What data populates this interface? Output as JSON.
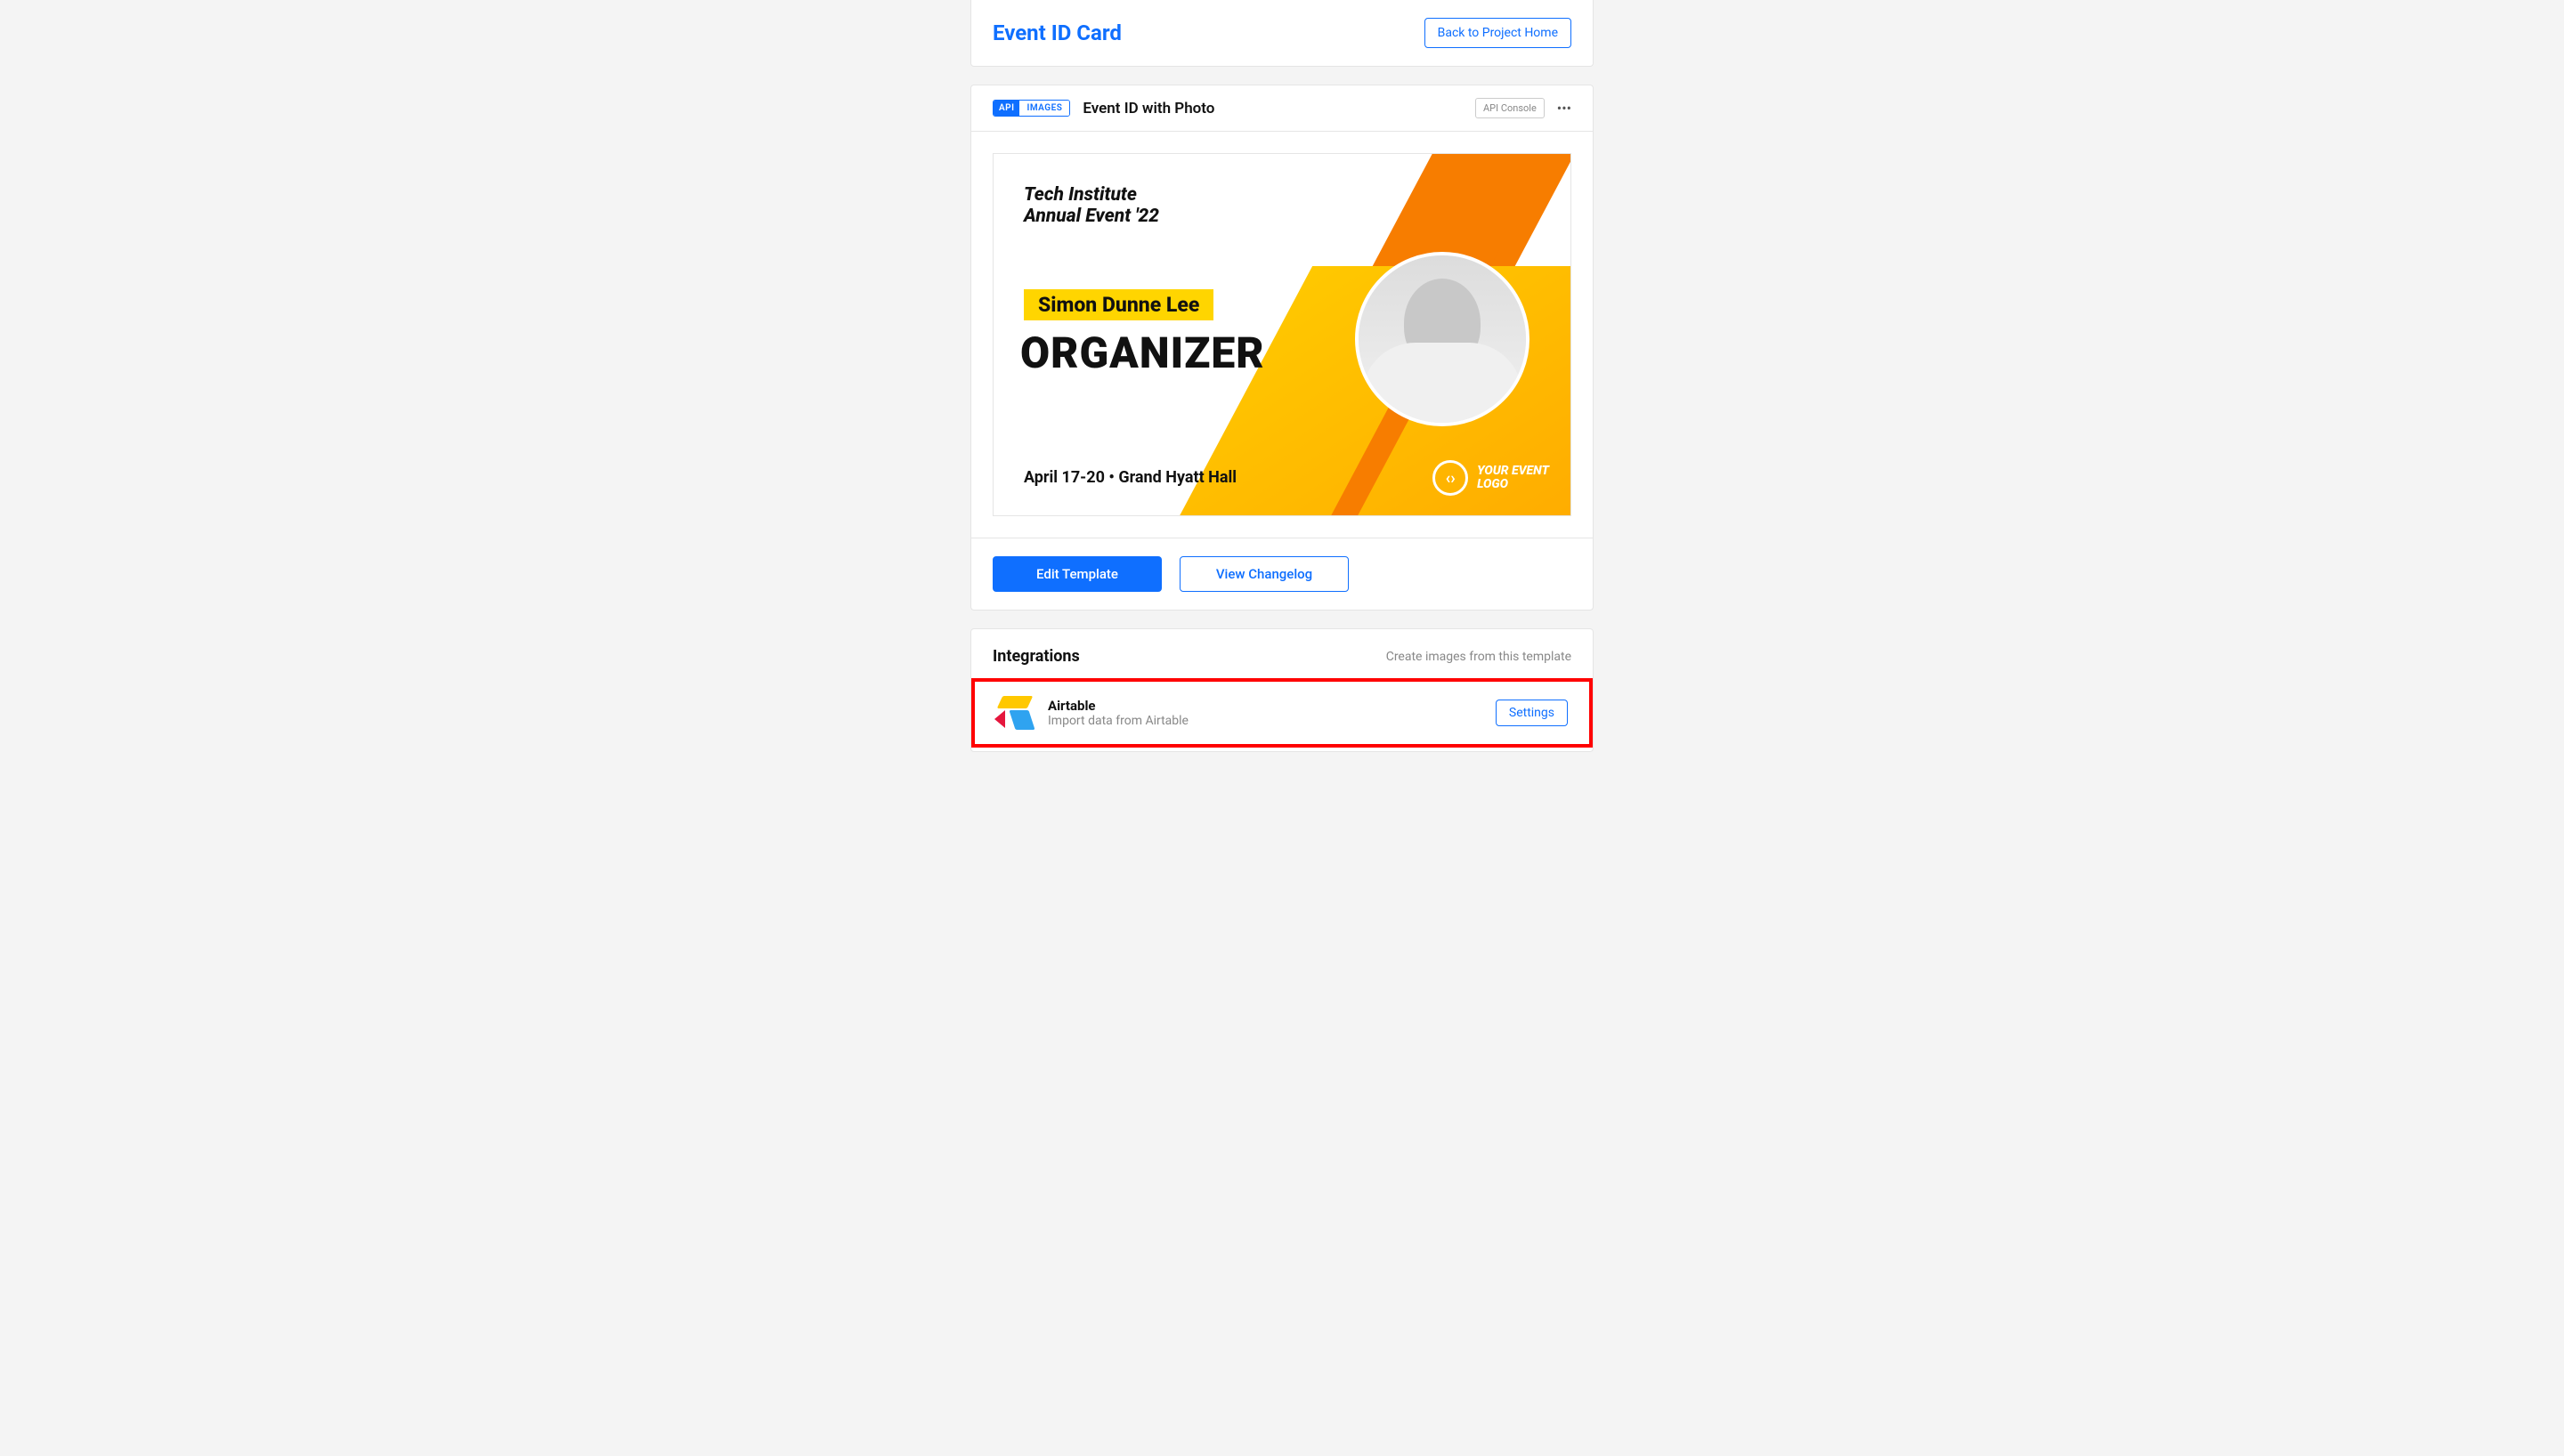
{
  "header": {
    "title": "Event ID Card",
    "back_label": "Back to Project Home"
  },
  "template": {
    "badge_api": "API",
    "badge_images": "IMAGES",
    "title": "Event ID with Photo",
    "api_console_label": "API Console",
    "more_icon": "•••",
    "preview": {
      "event_title_line1": "Tech Institute",
      "event_title_line2": "Annual Event '22",
      "attendee_name": "Simon Dunne Lee",
      "role": "ORGANIZER",
      "date_venue": "April 17-20 • Grand Hyatt Hall",
      "logo_symbol": "‹›",
      "logo_text_line1": "YOUR EVENT",
      "logo_text_line2": "LOGO"
    },
    "actions": {
      "edit_template": "Edit Template",
      "view_changelog": "View Changelog"
    }
  },
  "integrations": {
    "title": "Integrations",
    "subtitle": "Create images from this template",
    "item": {
      "icon": "airtable-icon",
      "name": "Airtable",
      "description": "Import data from Airtable",
      "settings_label": "Settings"
    }
  }
}
